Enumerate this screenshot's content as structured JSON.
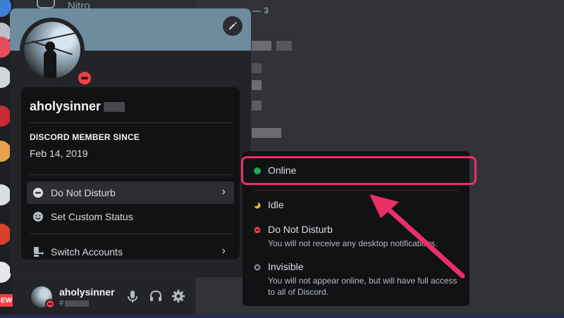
{
  "topbar": {
    "nitro_label": "Nitro",
    "members_count": "— 3"
  },
  "profile": {
    "username": "aholysinner",
    "member_since_label": "DISCORD MEMBER SINCE",
    "member_since_date": "Feb 14, 2019",
    "menu": {
      "status": "Do Not Disturb",
      "custom_status": "Set Custom Status",
      "switch_accounts": "Switch Accounts"
    }
  },
  "status_menu": {
    "online": {
      "label": "Online"
    },
    "idle": {
      "label": "Idle"
    },
    "dnd": {
      "label": "Do Not Disturb",
      "desc": "You will not receive any desktop notifications."
    },
    "invisible": {
      "label": "Invisible",
      "desc": "You will not appear online, but will have full access to all of Discord."
    }
  },
  "user_panel": {
    "name": "aholysinner",
    "tag": "#"
  },
  "server_rail": {
    "new_badge": "EW"
  },
  "colors": {
    "online": "#23a55a",
    "idle": "#f0b232",
    "dnd": "#f23f43",
    "invisible": "#80848e",
    "highlight": "#ea2e68"
  }
}
